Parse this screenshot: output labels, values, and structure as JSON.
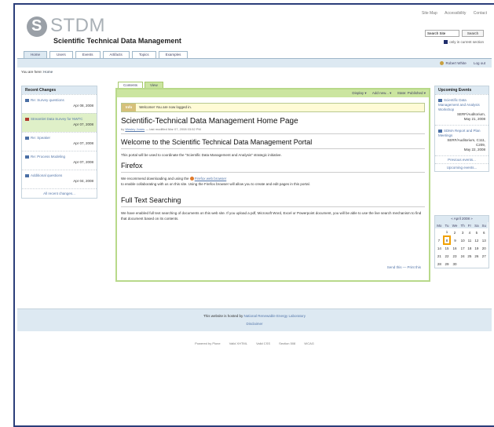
{
  "site_actions": [
    "Site Map",
    "Accessibility",
    "Contact"
  ],
  "brand": {
    "short": "STDM",
    "full": "Scientific Technical Data Management"
  },
  "search": {
    "value": "Search Site",
    "button": "Search",
    "only_section": "only in current section"
  },
  "tabs": [
    "Home",
    "Users",
    "Events",
    "Artifacts",
    "Topics",
    "Examples"
  ],
  "user": {
    "name": "Robert White",
    "logout": "Log out"
  },
  "breadcrumb": {
    "label": "You are here:",
    "current": "Home"
  },
  "recent_changes": {
    "title": "Recent Changes",
    "items": [
      {
        "label": "Re: Survey questions",
        "date": "Apr 08, 2008"
      },
      {
        "label": "Streamlet Data Survey for NWTC",
        "date": "Apr 07, 2008"
      },
      {
        "label": "Re: Speaker",
        "date": "Apr 07, 2008"
      },
      {
        "label": "Re: Process Modeling",
        "date": "Apr 07, 2008"
      },
      {
        "label": "Additional questions",
        "date": "Apr 04, 2008"
      }
    ],
    "all_link": "All recent changes..."
  },
  "content_tabs": [
    "Contents",
    "View"
  ],
  "content_actions": [
    "Display ▾",
    "Add new... ▾",
    "State: Published ▾"
  ],
  "info": {
    "label": "Info",
    "message": "Welcome! You are now logged in."
  },
  "page": {
    "title": "Scientific-Technical Data Management Home Page",
    "byline_by": "by",
    "byline_author": "Wesley Jones",
    "byline_rest": "— last modified Mar 07, 2008 03:52 PM",
    "welcome_heading": "Welcome to the Scientific Technical Data Management Portal",
    "welcome_text": "This portal will be used to coordinate the \"Scientific Data Management and Analysis\" strategic initiative.",
    "firefox_heading": "Firefox",
    "firefox_text_1": "We recommend downloading and using the",
    "firefox_link": "Firefox web browser",
    "firefox_text_2": "to enable collaborating with us on this site.  Using the Firefox browser will allow you to create and edit pages in this portal.",
    "fts_heading": "Full Text Searching",
    "fts_text": "We have enabled full text searching of documents on this web site.  If you upload a pdf, Microsoft Word, Excel or Powerpoint document, you will be able to use the live search mechanism to find that document based on its contents.",
    "send_this": "Send this",
    "print_this": "Print this"
  },
  "upcoming_events": {
    "title": "Upcoming Events",
    "items": [
      {
        "title": "Scientific Data Management and Analysis Workshop",
        "location": "SERF/Auditorium,",
        "date": "May 21, 2008"
      },
      {
        "title": "SDMA Report and Plan Meetings",
        "location": "SERF/Auditorium, C111, C209,",
        "date": "May 22, 2008"
      }
    ],
    "previous": "Previous events...",
    "upcoming": "Upcoming events..."
  },
  "calendar": {
    "month": "« April 2008 »",
    "days": [
      "Mo",
      "Tu",
      "We",
      "Th",
      "Fr",
      "Sa",
      "Su"
    ],
    "weeks": [
      [
        "",
        "1",
        "2",
        "3",
        "4",
        "5",
        "6"
      ],
      [
        "7",
        "8",
        "9",
        "10",
        "11",
        "12",
        "13"
      ],
      [
        "14",
        "15",
        "16",
        "17",
        "18",
        "19",
        "20"
      ],
      [
        "21",
        "22",
        "23",
        "24",
        "25",
        "26",
        "27"
      ],
      [
        "28",
        "29",
        "30",
        "",
        "",
        "",
        ""
      ]
    ],
    "today": "8"
  },
  "footer": {
    "hosted_prefix": "This website is hosted by",
    "hosted_link": "National Renewable Energy Laboratory",
    "disclaimer": "Disclaimer"
  },
  "badges": [
    "Powered by Plone",
    "Valid XHTML",
    "Valid CSS",
    "Section 508",
    "WCAG"
  ]
}
